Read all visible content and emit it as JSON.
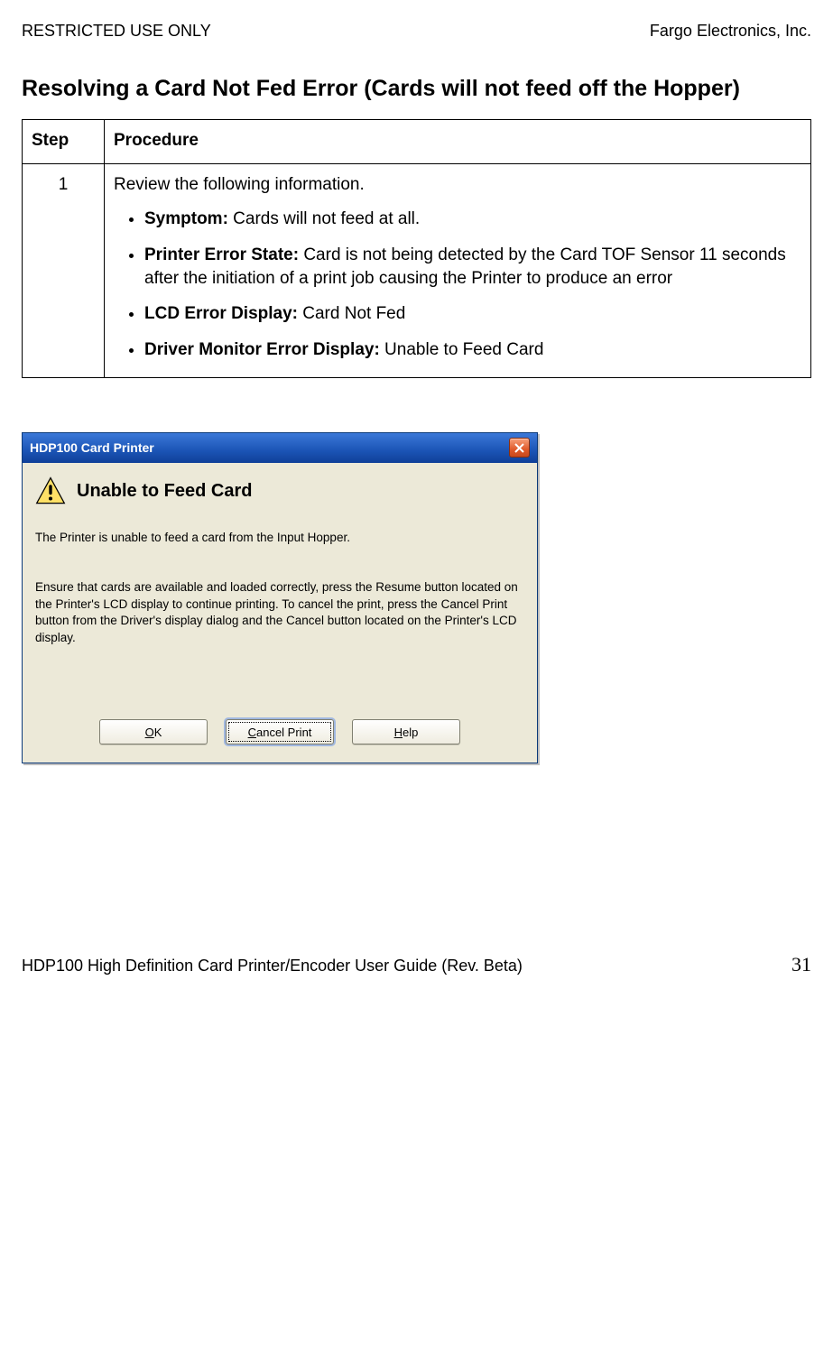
{
  "header": {
    "left": "RESTRICTED USE ONLY",
    "right": "Fargo Electronics, Inc."
  },
  "section_title": "Resolving a Card Not Fed Error (Cards will not feed off the Hopper)",
  "table": {
    "col_step": "Step",
    "col_procedure": "Procedure",
    "row1": {
      "num": "1",
      "intro": "Review the following information.",
      "items": {
        "symptom_label": "Symptom:",
        "symptom_text": " Cards will not feed at all.",
        "state_label": "Printer Error State:",
        "state_text": " Card is not being detected by the Card TOF Sensor 11 seconds after the initiation of a print job causing the Printer to produce an error",
        "lcd_label": "LCD Error Display:",
        "lcd_text": " Card Not Fed",
        "drv_label": "Driver Monitor Error Display:",
        "drv_text": " Unable to Feed Card"
      }
    }
  },
  "dialog": {
    "title": "HDP100 Card Printer",
    "error_heading": "Unable to Feed Card",
    "msg1": "The Printer is unable to feed a card from the Input Hopper.",
    "msg2": "Ensure that cards are available and loaded correctly, press the Resume button located on the Printer's LCD display to continue printing. To cancel the print, press the Cancel Print button from the Driver's display dialog and the Cancel button located on the Printer's LCD display.",
    "buttons": {
      "ok_u": "O",
      "ok_rest": "K",
      "cancel_u": "C",
      "cancel_rest": "ancel Print",
      "help_u": "H",
      "help_rest": "elp"
    }
  },
  "footer": {
    "left": "HDP100 High Definition Card Printer/Encoder User Guide (Rev. Beta)",
    "page": "31"
  }
}
